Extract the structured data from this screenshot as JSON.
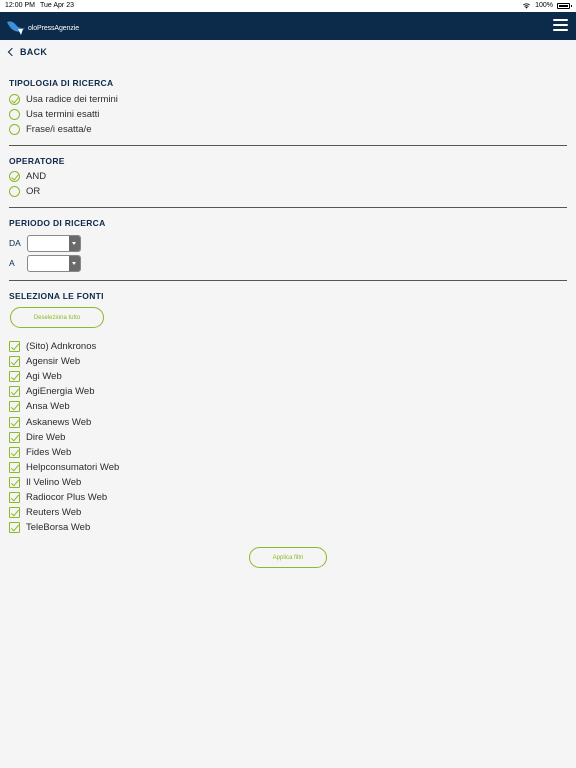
{
  "status_bar": {
    "time": "12:00 PM",
    "date": "Tue Apr 23",
    "battery": "100%",
    "icons": [
      "wifi-icon",
      "battery-icon"
    ]
  },
  "navbar": {
    "logo_text": "oloPressAgenzie",
    "menu_icon": "hamburger-menu-icon",
    "background_color": "#0c2a4a"
  },
  "back": {
    "label": "BACK"
  },
  "tipologia": {
    "title": "TIPOLOGIA DI RICERCA",
    "options": [
      {
        "label": "Usa radice dei termini",
        "selected": true
      },
      {
        "label": "Usa termini esatti",
        "selected": false
      },
      {
        "label": "Frase/i esatta/e",
        "selected": false
      }
    ]
  },
  "operatore": {
    "title": "OPERATORE",
    "options": [
      {
        "label": "AND",
        "selected": true
      },
      {
        "label": "OR",
        "selected": false
      }
    ]
  },
  "periodo": {
    "title": "PERIODO DI RICERCA",
    "from_label": "DA",
    "to_label": "A",
    "from_value": "",
    "to_value": ""
  },
  "fonti": {
    "title": "SELEZIONA LE FONTI",
    "deselect_label": "Deseleziona tutto",
    "sources": [
      {
        "label": "(Sito) Adnkronos",
        "checked": true
      },
      {
        "label": "Agensir Web",
        "checked": true
      },
      {
        "label": "Agi Web",
        "checked": true
      },
      {
        "label": "AgiEnergia Web",
        "checked": true
      },
      {
        "label": "Ansa Web",
        "checked": true
      },
      {
        "label": "Askanews Web",
        "checked": true
      },
      {
        "label": "Dire Web",
        "checked": true
      },
      {
        "label": "Fides Web",
        "checked": true
      },
      {
        "label": "Helpconsumatori Web",
        "checked": true
      },
      {
        "label": "Il Velino Web",
        "checked": true
      },
      {
        "label": "Radiocor Plus Web",
        "checked": true
      },
      {
        "label": "Reuters Web",
        "checked": true
      },
      {
        "label": "TeleBorsa Web",
        "checked": true
      }
    ]
  },
  "apply": {
    "label": "Applica filtri"
  },
  "colors": {
    "accent": "#8bb92a",
    "navy": "#0c2a4a",
    "background": "#f5f5f5"
  }
}
